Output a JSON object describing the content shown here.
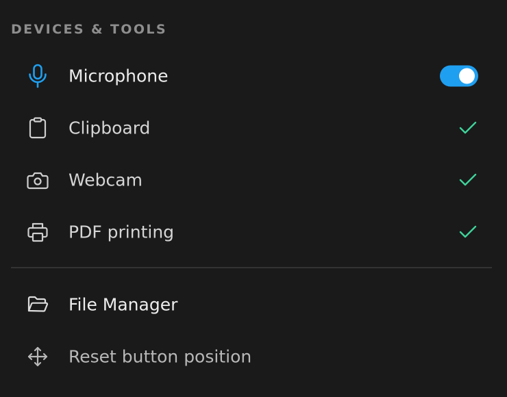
{
  "section": {
    "title": "DEVICES & TOOLS"
  },
  "items": [
    {
      "label": "Microphone",
      "icon": "microphone-icon",
      "control": "toggle",
      "toggle_on": true
    },
    {
      "label": "Clipboard",
      "icon": "clipboard-icon",
      "control": "check",
      "checked": true
    },
    {
      "label": "Webcam",
      "icon": "camera-icon",
      "control": "check",
      "checked": true
    },
    {
      "label": "PDF printing",
      "icon": "printer-icon",
      "control": "check",
      "checked": true
    }
  ],
  "actions": [
    {
      "label": "File Manager",
      "icon": "folder-open-icon"
    },
    {
      "label": "Reset button position",
      "icon": "move-arrows-icon"
    }
  ],
  "colors": {
    "background": "#1a1a1a",
    "accent": "#1f9ff0",
    "check": "#3fd39a",
    "section_title": "#8e8e8e",
    "divider": "#333333"
  }
}
